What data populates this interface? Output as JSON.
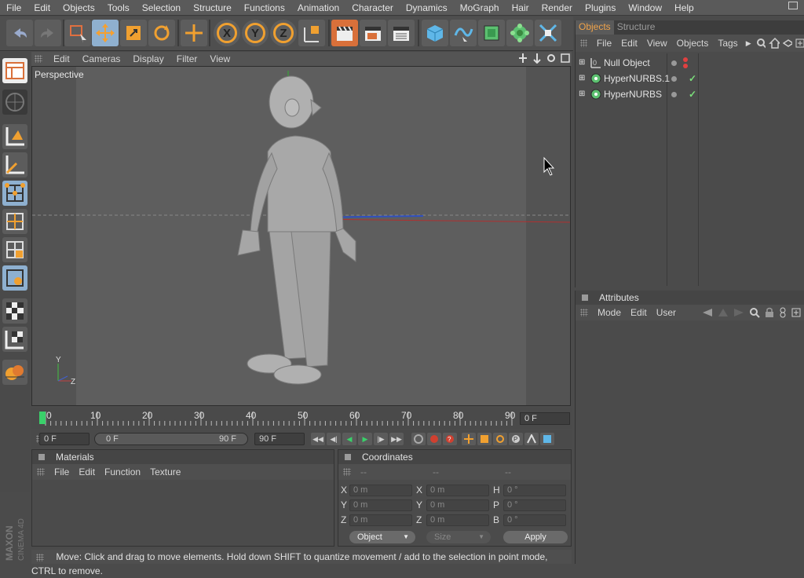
{
  "menubar": [
    "File",
    "Edit",
    "Objects",
    "Tools",
    "Selection",
    "Structure",
    "Functions",
    "Animation",
    "Character",
    "Dynamics",
    "MoGraph",
    "Hair",
    "Render",
    "Plugins",
    "Window",
    "Help"
  ],
  "toolbar": {
    "axis_x": "X",
    "axis_y": "Y",
    "axis_z": "Z"
  },
  "viewport": {
    "menu": [
      "Edit",
      "Cameras",
      "Display",
      "Filter",
      "View"
    ],
    "label": "Perspective",
    "axis_y": "Y",
    "axis_z": "Z"
  },
  "timeline": {
    "ticks": [
      "0",
      "10",
      "20",
      "30",
      "40",
      "50",
      "60",
      "70",
      "80",
      "90"
    ],
    "current_frame": "0 F"
  },
  "playback": {
    "start": "0 F",
    "range_start": "0 F",
    "range_end": "90 F",
    "end": "90 F"
  },
  "materials": {
    "title": "Materials",
    "menu": [
      "File",
      "Edit",
      "Function",
      "Texture"
    ]
  },
  "coordinates": {
    "title": "Coordinates",
    "col_headers": [
      "--",
      "--",
      "--"
    ],
    "rows": [
      {
        "l1": "X",
        "v1": "0 m",
        "l2": "X",
        "v2": "0 m",
        "l3": "H",
        "v3": "0 °"
      },
      {
        "l1": "Y",
        "v1": "0 m",
        "l2": "Y",
        "v2": "0 m",
        "l3": "P",
        "v3": "0 °"
      },
      {
        "l1": "Z",
        "v1": "0 m",
        "l2": "Z",
        "v2": "0 m",
        "l3": "B",
        "v3": "0 °"
      }
    ],
    "mode": "Object",
    "size": "Size",
    "apply": "Apply"
  },
  "status": "Move: Click and drag to move elements. Hold down SHIFT to quantize movement / add to the selection in point mode, CTRL to remove.",
  "objects_panel": {
    "tab_objects": "Objects",
    "tab_structure": "Structure",
    "menu": [
      "File",
      "Edit",
      "View",
      "Objects",
      "Tags"
    ],
    "items": [
      {
        "name": "Null Object"
      },
      {
        "name": "HyperNURBS.1"
      },
      {
        "name": "HyperNURBS"
      }
    ]
  },
  "attributes_panel": {
    "title": "Attributes",
    "menu": [
      "Mode",
      "Edit",
      "User"
    ]
  },
  "brand": "MAXON CINEMA 4D",
  "colors": {
    "accent_orange": "#d9703a",
    "accent_blue": "#8fb0cf",
    "tab_active": "#f0a34a"
  }
}
